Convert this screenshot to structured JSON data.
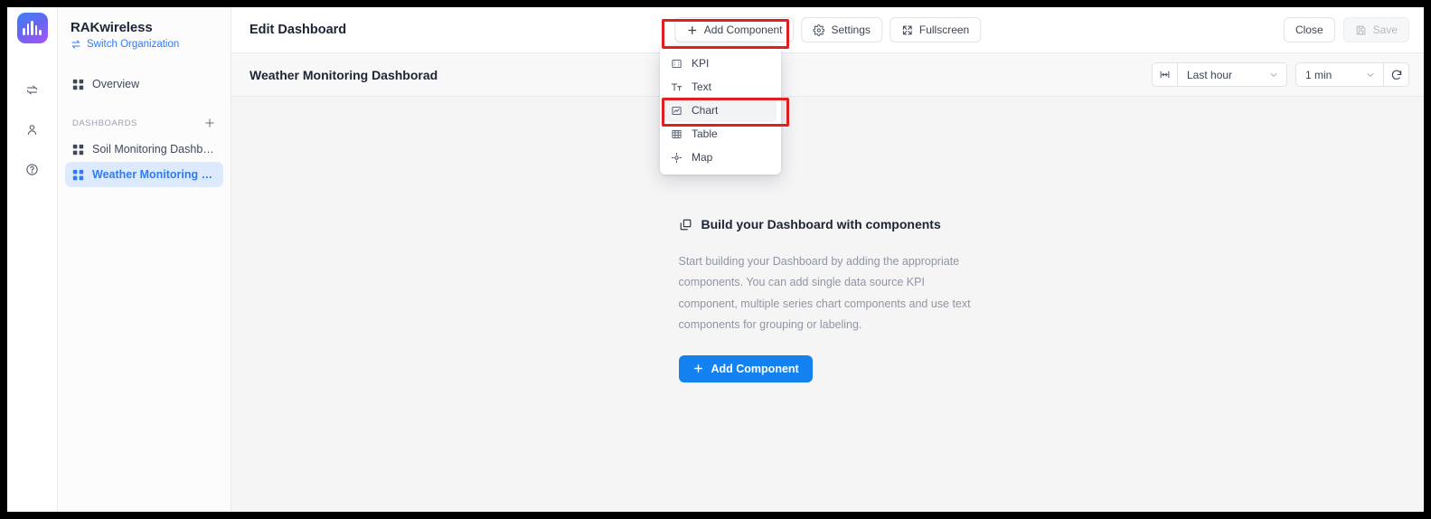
{
  "brand": {
    "logo_icon": "waveform-logo-icon",
    "gradient_from": "#3b82f6",
    "gradient_to": "#a855f7"
  },
  "rail": {
    "items": [
      {
        "icon": "switch-arrows-icon",
        "name": "switch-icon"
      },
      {
        "icon": "user-icon",
        "name": "user-icon"
      },
      {
        "icon": "help-circle-icon",
        "name": "help-icon"
      }
    ]
  },
  "sidebar": {
    "org_name": "RAKwireless",
    "switch_org_label": "Switch Organization",
    "switch_org_icon": "switch-horizontal-icon",
    "overview_label": "Overview",
    "overview_icon": "grid-icon",
    "section_title": "DASHBOARDS",
    "add_dashboard_icon": "plus-icon",
    "dashboards": [
      {
        "label": "Soil Monitoring Dashbo...",
        "icon": "grid-icon",
        "active": false
      },
      {
        "label": "Weather Monitoring D...",
        "icon": "grid-icon",
        "active": true
      }
    ],
    "active_color": "#2f7bf6",
    "active_bg": "#ddeafd"
  },
  "topbar": {
    "page_title": "Edit Dashboard",
    "add_component_label": "Add Component",
    "add_component_icon": "plus-icon",
    "settings_label": "Settings",
    "settings_icon": "gear-icon",
    "fullscreen_label": "Fullscreen",
    "fullscreen_icon": "fullscreen-icon",
    "close_label": "Close",
    "save_label": "Save",
    "save_icon": "floppy-disk-icon",
    "save_disabled": true
  },
  "dropdown": {
    "open": true,
    "items": [
      {
        "label": "KPI",
        "icon": "kpi-icon",
        "highlighted": false
      },
      {
        "label": "Text",
        "icon": "text-icon",
        "highlighted": false
      },
      {
        "label": "Chart",
        "icon": "chart-icon",
        "highlighted": true
      },
      {
        "label": "Table",
        "icon": "table-icon",
        "highlighted": false
      },
      {
        "label": "Map",
        "icon": "map-pin-icon",
        "highlighted": false
      }
    ]
  },
  "subbar": {
    "dashboard_title": "Weather Monitoring Dashborad",
    "range_icon": "range-bar-icon",
    "time_range_value": "Last hour",
    "refresh_interval_value": "1 min",
    "refresh_icon": "refresh-icon",
    "chevron_icon": "chevron-down-icon"
  },
  "empty_state": {
    "icon": "layers-copy-icon",
    "heading": "Build your Dashboard with components",
    "body": "Start building your Dashboard by adding the appropriate components. You can add single data source KPI component, multiple series chart components and use text components for grouping or labeling.",
    "cta_label": "Add Component",
    "cta_icon": "plus-icon",
    "cta_color": "#1481f0"
  },
  "annotations": {
    "highlight_color": "#e02020",
    "boxes": [
      {
        "target": "add-component-button"
      },
      {
        "target": "dropdown-item-chart"
      }
    ]
  }
}
